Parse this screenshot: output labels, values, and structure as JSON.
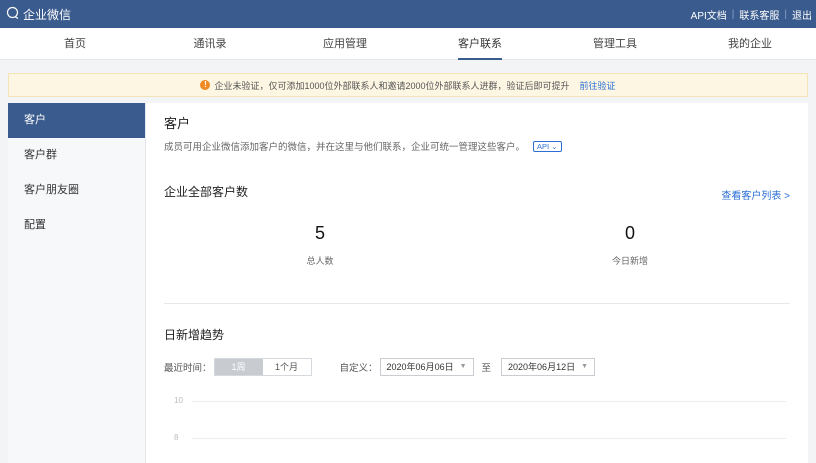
{
  "app": {
    "title": "企业微信"
  },
  "top_links": [
    "API文档",
    "联系客服",
    "退出"
  ],
  "nav": [
    {
      "label": "首页"
    },
    {
      "label": "通讯录"
    },
    {
      "label": "应用管理"
    },
    {
      "label": "客户联系",
      "active": true
    },
    {
      "label": "管理工具"
    },
    {
      "label": "我的企业"
    }
  ],
  "notice": {
    "text": "企业未验证，仅可添加1000位外部联系人和邀请2000位外部联系人进群，验证后即可提升",
    "link": "前往验证"
  },
  "sidebar": {
    "items": [
      {
        "label": "客户",
        "active": true
      },
      {
        "label": "客户群"
      },
      {
        "label": "客户朋友圈"
      },
      {
        "label": "配置"
      }
    ]
  },
  "main": {
    "title": "客户",
    "description": "成员可用企业微信添加客户的微信，并在这里与他们联系，企业可统一管理这些客户。",
    "api_tag": "API",
    "total_section": {
      "title": "企业全部客户数",
      "link": "查看客户列表 >",
      "stats": [
        {
          "value": "5",
          "label": "总人数"
        },
        {
          "value": "0",
          "label": "今日新增"
        }
      ]
    },
    "trend": {
      "title": "日新增趋势",
      "range_label": "最近时间：",
      "ranges": [
        {
          "label": "1周",
          "active": true
        },
        {
          "label": "1个月"
        }
      ],
      "custom_label": "自定义：",
      "start_date": "2020年06月06日",
      "to_label": "至",
      "end_date": "2020年06月12日",
      "y_ticks": [
        "10",
        "8"
      ]
    }
  },
  "colors": {
    "brand": "#3a5b8d",
    "link": "#2b6fd6",
    "warning": "#f08a24"
  }
}
